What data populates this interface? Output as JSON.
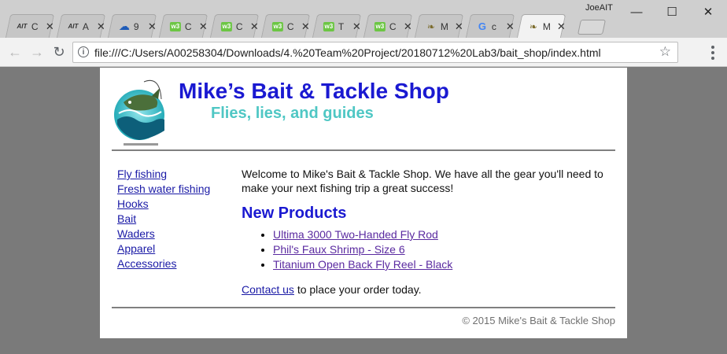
{
  "browser": {
    "user_label": "JoeAIT",
    "tabs": [
      {
        "icon": "ait-icon",
        "title": "C"
      },
      {
        "icon": "ait-icon",
        "title": "A"
      },
      {
        "icon": "onedrive-icon",
        "title": "9"
      },
      {
        "icon": "w3schools-icon",
        "title": "C"
      },
      {
        "icon": "w3schools-icon",
        "title": "C"
      },
      {
        "icon": "w3schools-icon",
        "title": "C"
      },
      {
        "icon": "w3schools-icon",
        "title": "T"
      },
      {
        "icon": "w3schools-icon",
        "title": "C"
      },
      {
        "icon": "fish-icon",
        "title": "M"
      },
      {
        "icon": "google-icon",
        "title": "c"
      },
      {
        "icon": "fish-icon",
        "title": "M",
        "active": true
      }
    ],
    "tab_close_glyph": "✕",
    "url": "file:///C:/Users/A00258304/Downloads/4.%20Team%20Project/20180712%20Lab3/bait_shop/index.html",
    "window_controls": {
      "minimize": "—",
      "maximize": "☐",
      "close": "✕"
    },
    "nav": {
      "back": "←",
      "forward": "→",
      "reload": "↻"
    }
  },
  "site": {
    "title": "Mike’s Bait & Tackle Shop",
    "tagline": "Flies, lies, and guides",
    "nav_links": [
      "Fly fishing",
      "Fresh water fishing",
      "Hooks",
      "Bait",
      "Waders",
      "Apparel",
      "Accessories"
    ],
    "welcome_text": "Welcome to Mike's Bait & Tackle Shop. We have all the gear you'll need to make your next fishing trip a great success!",
    "new_products_heading": "New Products",
    "products": [
      "Ultima 3000 Two-Handed Fly Rod",
      "Phil's Faux Shrimp - Size 6",
      "Titanium Open Back Fly Reel - Black"
    ],
    "contact_link": "Contact us",
    "contact_rest": " to place your order today.",
    "footer": "© 2015 Mike's Bait & Tackle Shop"
  }
}
